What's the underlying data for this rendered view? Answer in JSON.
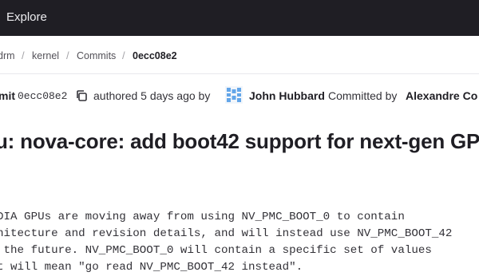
{
  "topbar": {
    "explore_label": "Explore"
  },
  "breadcrumb": {
    "items": [
      "drm",
      "kernel",
      "Commits",
      "0ecc08e2"
    ],
    "separator": "/"
  },
  "commit_info": {
    "commit_label": "mit",
    "sha": "0ecc08e2",
    "authored_text": "authored 5 days ago by",
    "author": "John Hubbard",
    "committed_text": "Committed by",
    "committer": "Alexandre Co"
  },
  "commit_title": "u: nova-core: add boot42 support for next-gen GP",
  "commit_message": [
    "DIA GPUs are moving away from using NV_PMC_BOOT_0 to contain",
    "hitecture and revision details, and will instead use NV_PMC_BOOT_42",
    " the future. NV_PMC_BOOT_0 will contain a specific set of values",
    "t will mean \"go read NV_PMC_BOOT_42 instead\"."
  ],
  "colors": {
    "topbar_bg": "#1f1e24",
    "text": "#333238",
    "muted": "#535158",
    "avatar_accent": "#63a6e9"
  },
  "icons": [
    "copy-icon",
    "identicon-avatar"
  ]
}
